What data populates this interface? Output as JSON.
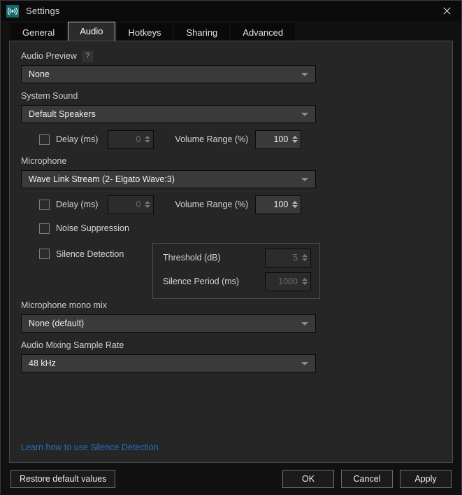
{
  "window": {
    "title": "Settings",
    "app_icon": "broadcast-icon",
    "close_icon": "close-icon",
    "accent_color": "#16696b",
    "link_color": "#1f74c4",
    "panel_bg": "#262626"
  },
  "tabs": [
    {
      "label": "General",
      "active": false
    },
    {
      "label": "Audio",
      "active": true
    },
    {
      "label": "Hotkeys",
      "active": false
    },
    {
      "label": "Sharing",
      "active": false
    },
    {
      "label": "Advanced",
      "active": false
    }
  ],
  "audio_preview": {
    "label": "Audio Preview",
    "help_icon": "question-mark-icon",
    "value": "None"
  },
  "system_sound": {
    "label": "System Sound",
    "value": "Default Speakers",
    "delay": {
      "label": "Delay (ms)",
      "checked": false,
      "value": "0",
      "enabled": false
    },
    "volume_range": {
      "label": "Volume Range (%)",
      "value": "100",
      "enabled": true
    }
  },
  "microphone": {
    "label": "Microphone",
    "value": "Wave Link Stream (2- Elgato Wave:3)",
    "delay": {
      "label": "Delay (ms)",
      "checked": false,
      "value": "0",
      "enabled": false
    },
    "volume_range": {
      "label": "Volume Range (%)",
      "value": "100",
      "enabled": true
    },
    "noise_suppression": {
      "label": "Noise Suppression",
      "checked": false
    },
    "silence_detection": {
      "label": "Silence Detection",
      "checked": false,
      "threshold": {
        "label": "Threshold (dB)",
        "value": "5",
        "enabled": false
      },
      "silence_period": {
        "label": "Silence Period (ms)",
        "value": "1000",
        "enabled": false
      }
    }
  },
  "mono_mix": {
    "label": "Microphone mono mix",
    "value": "None (default)"
  },
  "sample_rate": {
    "label": "Audio Mixing Sample Rate",
    "value": "48 kHz"
  },
  "learn_link": {
    "label": "Learn how to use Silence Detection"
  },
  "footer": {
    "restore": "Restore default values",
    "ok": "OK",
    "cancel": "Cancel",
    "apply": "Apply"
  }
}
